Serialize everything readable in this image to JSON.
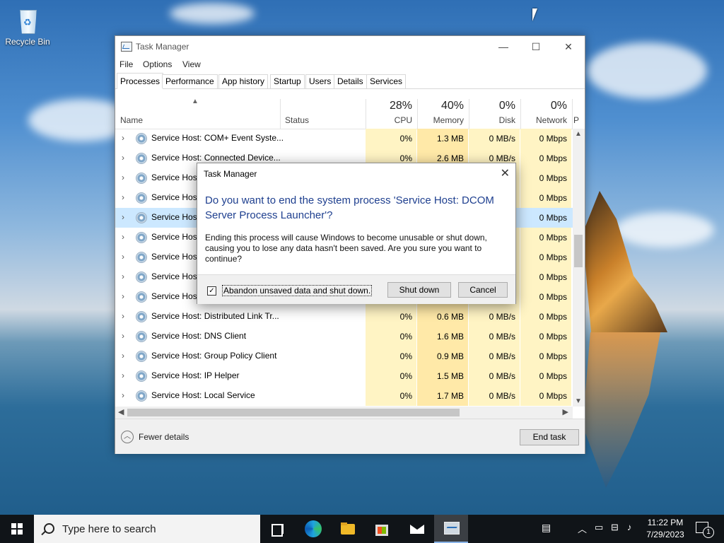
{
  "desktop": {
    "recycle_bin_label": "Recycle Bin"
  },
  "task_manager": {
    "title": "Task Manager",
    "menu": [
      "File",
      "Options",
      "View"
    ],
    "tabs": [
      "Processes",
      "Performance",
      "App history",
      "Startup",
      "Users",
      "Details",
      "Services"
    ],
    "active_tab": "Processes",
    "columns": {
      "name": "Name",
      "status": "Status",
      "cpu_pct": "28%",
      "cpu": "CPU",
      "memory_pct": "40%",
      "memory": "Memory",
      "disk_pct": "0%",
      "disk": "Disk",
      "network_pct": "0%",
      "network": "Network",
      "power_cut": "P"
    },
    "rows": [
      {
        "name": "Service Host: COM+ Event Syste...",
        "cpu": "0%",
        "memory": "1.3 MB",
        "disk": "0 MB/s",
        "network": "0 Mbps"
      },
      {
        "name": "Service Host: Connected Device...",
        "cpu": "0%",
        "memory": "2.6 MB",
        "disk": "0 MB/s",
        "network": "0 Mbps"
      },
      {
        "name": "Service Host",
        "cpu": "",
        "memory": "",
        "disk": "",
        "network": "0 Mbps"
      },
      {
        "name": "Service Host",
        "cpu": "",
        "memory": "",
        "disk": "",
        "network": "0 Mbps"
      },
      {
        "name": "Service Host",
        "cpu": "",
        "memory": "",
        "disk": "",
        "network": "0 Mbps"
      },
      {
        "name": "Service Host",
        "cpu": "",
        "memory": "",
        "disk": "",
        "network": "0 Mbps"
      },
      {
        "name": "Service Host",
        "cpu": "",
        "memory": "",
        "disk": "",
        "network": "0 Mbps"
      },
      {
        "name": "Service Host",
        "cpu": "",
        "memory": "",
        "disk": "",
        "network": "0 Mbps"
      },
      {
        "name": "Service Host",
        "cpu": "",
        "memory": "",
        "disk": "",
        "network": "0 Mbps"
      },
      {
        "name": "Service Host: Distributed Link Tr...",
        "cpu": "0%",
        "memory": "0.6 MB",
        "disk": "0 MB/s",
        "network": "0 Mbps"
      },
      {
        "name": "Service Host: DNS Client",
        "cpu": "0%",
        "memory": "1.6 MB",
        "disk": "0 MB/s",
        "network": "0 Mbps"
      },
      {
        "name": "Service Host: Group Policy Client",
        "cpu": "0%",
        "memory": "0.9 MB",
        "disk": "0 MB/s",
        "network": "0 Mbps"
      },
      {
        "name": "Service Host: IP Helper",
        "cpu": "0%",
        "memory": "1.5 MB",
        "disk": "0 MB/s",
        "network": "0 Mbps"
      },
      {
        "name": "Service Host: Local Service",
        "cpu": "0%",
        "memory": "1.7 MB",
        "disk": "0 MB/s",
        "network": "0 Mbps"
      }
    ],
    "selected_row_index": 4,
    "fewer_details": "Fewer details",
    "end_task": "End task"
  },
  "dialog": {
    "title": "Task Manager",
    "question": "Do you want to end the system process 'Service Host: DCOM Server Process Launcher'?",
    "body": "Ending this process will cause Windows to become unusable or shut down, causing you to lose any data hasn't been saved. Are you sure you want to continue?",
    "checkbox_label": "Abandon unsaved data and shut down.",
    "checkbox_checked": true,
    "shutdown_label": "Shut down",
    "cancel_label": "Cancel"
  },
  "taskbar": {
    "search_placeholder": "Type here to search",
    "time": "11:22 PM",
    "date": "7/29/2023",
    "notification_count": "1"
  }
}
